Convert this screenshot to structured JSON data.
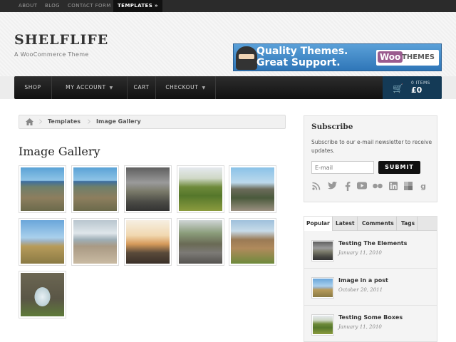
{
  "topbar": {
    "links": [
      {
        "label": "ABOUT"
      },
      {
        "label": "BLOG"
      },
      {
        "label": "CONTACT FORM"
      },
      {
        "label": "TEMPLATES »"
      }
    ]
  },
  "header": {
    "logo": "SHELFLIFE",
    "tagline": "A WooCommerce Theme",
    "banner": {
      "line1": "Quality Themes.",
      "line2": "Great Support.",
      "brand_woo": "Woo",
      "brand_themes": "THEMES"
    }
  },
  "nav": {
    "items": [
      {
        "label": "SHOP"
      },
      {
        "label": "MY ACCOUNT"
      },
      {
        "label": "CART"
      },
      {
        "label": "CHECKOUT"
      }
    ],
    "cart": {
      "items_label": "0 ITEMS",
      "total": "£0"
    }
  },
  "breadcrumb": {
    "items": [
      "Templates",
      "Image Gallery"
    ]
  },
  "page": {
    "title": "Image Gallery"
  },
  "gallery": {
    "images": [
      {
        "photo": "coastal city"
      },
      {
        "photo": "coastal city"
      },
      {
        "photo": "stormy parking lot"
      },
      {
        "photo": "vineyard"
      },
      {
        "photo": "mountain town"
      },
      {
        "photo": "field and mountains"
      },
      {
        "photo": "beach"
      },
      {
        "photo": "sunset coast"
      },
      {
        "photo": "tree-lined road"
      },
      {
        "photo": "ruins"
      },
      {
        "photo": "stone arch"
      }
    ]
  },
  "subscribe": {
    "title": "Subscribe",
    "description": "Subscribe to our e-mail newsletter to receive updates.",
    "email_placeholder": "E-mail",
    "submit_label": "SUBMIT",
    "social_icons": [
      "rss-icon",
      "twitter-icon",
      "facebook-icon",
      "youtube-icon",
      "flickr-icon",
      "linkedin-icon",
      "delicious-icon",
      "googleplus-icon"
    ]
  },
  "tabs": {
    "labels": [
      "Popular",
      "Latest",
      "Comments",
      "Tags"
    ],
    "posts": [
      {
        "title": "Testing The Elements",
        "date": "January 11, 2010"
      },
      {
        "title": "Image in a post",
        "date": "October 20, 2011"
      },
      {
        "title": "Testing Some Boxes",
        "date": "January 11, 2010"
      }
    ]
  },
  "colors": {
    "topbar": "#2b2b2b",
    "nav": "#1a1a1a",
    "cart": "#143a56",
    "accent": "#111111"
  }
}
